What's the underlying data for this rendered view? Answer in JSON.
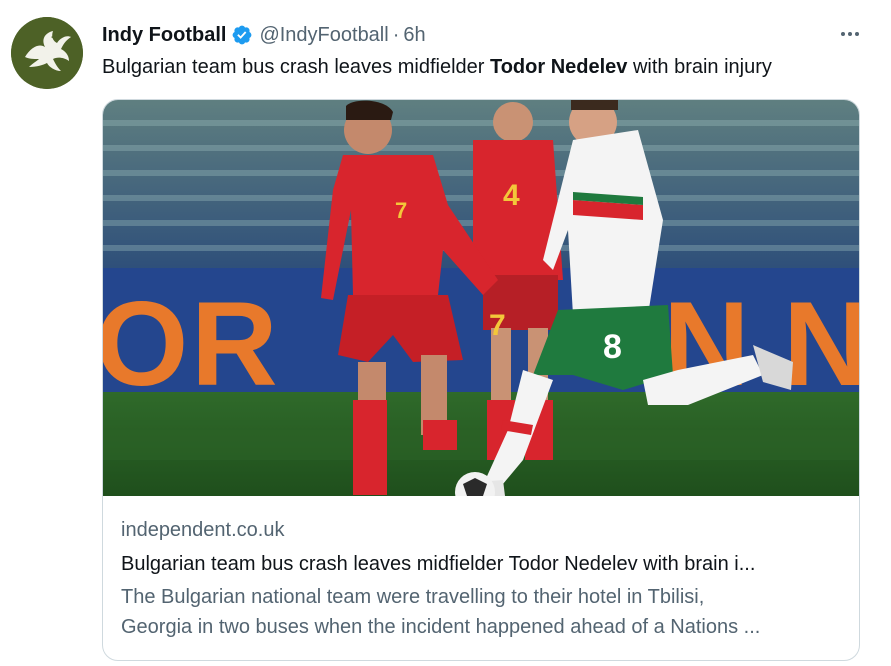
{
  "account": {
    "display_name": "Indy Football",
    "handle": "@IndyFootball",
    "separator": "·",
    "time": "6h",
    "avatar_icon": "eagle-logo",
    "verified_icon": "verified-badge-icon"
  },
  "tweet": {
    "text_before": "Bulgarian team bus crash leaves midfielder ",
    "text_bold": "Todor Nedelev",
    "text_after": " with brain injury"
  },
  "more_icon": "more-options-icon",
  "card": {
    "image_description_icon": "football-photo",
    "domain": "independent.co.uk",
    "title": "Bulgarian team bus crash leaves midfielder Todor Nedelev with brain i...",
    "description_line1": "The Bulgarian national team were travelling to their hotel in Tbilisi,",
    "description_line2": "Georgia in two buses when the incident happened ahead of a Nations ..."
  },
  "photo": {
    "left_player_number": "7",
    "center_player_number": "4",
    "right_player_number": "8",
    "banner_letters": [
      "O",
      "R",
      "N",
      "N"
    ]
  },
  "colors": {
    "verified_blue": "#1d9bf0",
    "secondary_text": "#536471",
    "border": "#cfd9de",
    "wales_red": "#d8252d",
    "bulgaria_green": "#1f7a3e",
    "banner_orange": "#e8792b"
  }
}
